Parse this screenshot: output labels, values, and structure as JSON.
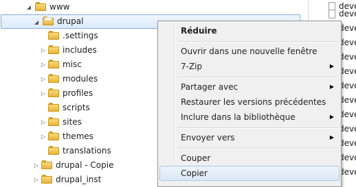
{
  "tree": {
    "items": [
      {
        "label": "www",
        "arrow": "◢"
      },
      {
        "label": "drupal",
        "arrow": "◢"
      },
      {
        "label": ".settings",
        "arrow": ""
      },
      {
        "label": "includes",
        "arrow": "▷"
      },
      {
        "label": "misc",
        "arrow": "▷"
      },
      {
        "label": "modules",
        "arrow": "▷"
      },
      {
        "label": "profiles",
        "arrow": "▷"
      },
      {
        "label": "scripts",
        "arrow": ""
      },
      {
        "label": "sites",
        "arrow": "▷"
      },
      {
        "label": "themes",
        "arrow": "▷"
      },
      {
        "label": "translations",
        "arrow": ""
      },
      {
        "label": "drupal - Copie",
        "arrow": "▷"
      },
      {
        "label": "drupal_inst",
        "arrow": "▷"
      }
    ]
  },
  "files": {
    "items": [
      "deve",
      "deve",
      "deve",
      "deve",
      "deve",
      "deve",
      "deve",
      "deve",
      "deve",
      "deve",
      "deve",
      "deve",
      "deve"
    ]
  },
  "context_menu": {
    "items": [
      {
        "label": "Réduire",
        "submenu_arrow": ""
      },
      {
        "label": "Ouvrir dans une nouvelle fenêtre",
        "submenu_arrow": ""
      },
      {
        "label": "7-Zip",
        "submenu_arrow": "▶"
      },
      {
        "label": "Partager avec",
        "submenu_arrow": "▶"
      },
      {
        "label": "Restaurer les versions précédentes",
        "submenu_arrow": ""
      },
      {
        "label": "Inclure dans la bibliothèque",
        "submenu_arrow": "▶"
      },
      {
        "label": "Envoyer vers",
        "submenu_arrow": "▶"
      },
      {
        "label": "Couper",
        "submenu_arrow": ""
      },
      {
        "label": "Copier",
        "submenu_arrow": ""
      }
    ]
  }
}
